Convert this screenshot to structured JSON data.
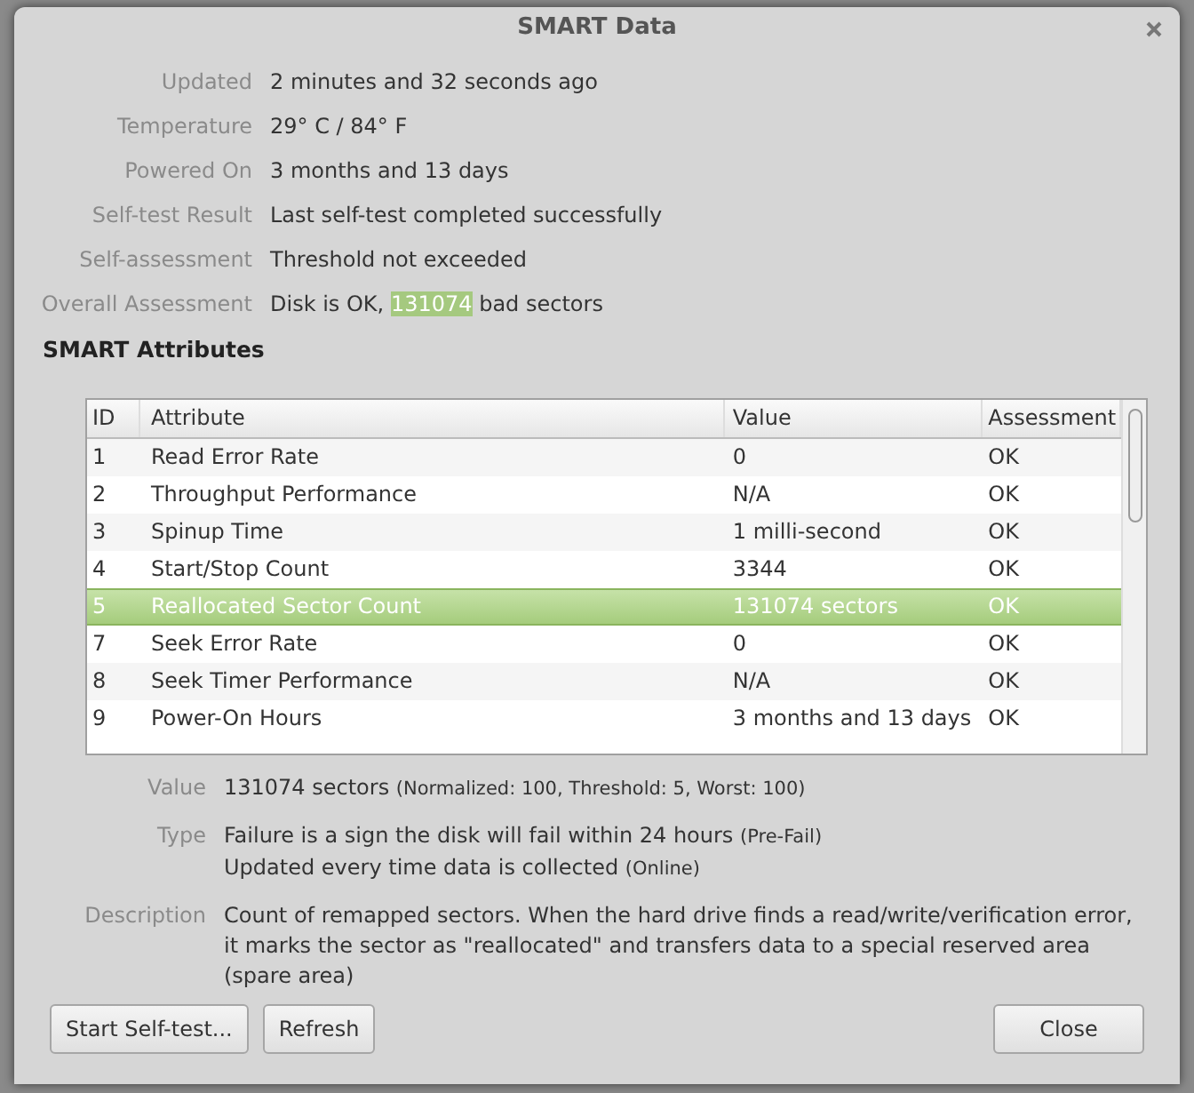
{
  "window": {
    "title": "SMART Data"
  },
  "summary": [
    {
      "label": "Updated",
      "value": "2 minutes and 32 seconds ago"
    },
    {
      "label": "Temperature",
      "value": "29° C / 84° F"
    },
    {
      "label": "Powered On",
      "value": "3 months and 13 days"
    },
    {
      "label": "Self-test Result",
      "value": "Last self-test completed successfully"
    },
    {
      "label": "Self-assessment",
      "value": "Threshold not exceeded"
    },
    {
      "label": "Overall Assessment",
      "value": "Disk is OK,",
      "highlight": "131074",
      "value_after": "bad sectors"
    }
  ],
  "section_title": "SMART Attributes",
  "table": {
    "columns": [
      "ID",
      "Attribute",
      "Value",
      "Assessment"
    ],
    "rows": [
      {
        "id": "1",
        "attribute": "Read Error Rate",
        "value": "0",
        "assessment": "OK",
        "selected": false
      },
      {
        "id": "2",
        "attribute": "Throughput Performance",
        "value": "N/A",
        "assessment": "OK",
        "selected": false
      },
      {
        "id": "3",
        "attribute": "Spinup Time",
        "value": "1 milli-second",
        "assessment": "OK",
        "selected": false
      },
      {
        "id": "4",
        "attribute": "Start/Stop Count",
        "value": "3344",
        "assessment": "OK",
        "selected": false
      },
      {
        "id": "5",
        "attribute": "Reallocated Sector Count",
        "value": "131074 sectors",
        "assessment": "OK",
        "selected": true
      },
      {
        "id": "7",
        "attribute": "Seek Error Rate",
        "value": "0",
        "assessment": "OK",
        "selected": false
      },
      {
        "id": "8",
        "attribute": "Seek Timer Performance",
        "value": "N/A",
        "assessment": "OK",
        "selected": false
      },
      {
        "id": "9",
        "attribute": "Power-On Hours",
        "value": "3 months and 13 days",
        "assessment": "OK",
        "selected": false
      }
    ]
  },
  "details": [
    {
      "label": "Value",
      "lines": [
        {
          "text": "131074 sectors",
          "note": "(Normalized: 100, Threshold: 5, Worst: 100)"
        }
      ]
    },
    {
      "label": "Type",
      "lines": [
        {
          "text": "Failure is a sign the disk will fail within 24 hours",
          "note": "(Pre-Fail)"
        },
        {
          "text": "Updated every time data is collected",
          "note": "(Online)"
        }
      ]
    },
    {
      "label": "Description",
      "lines": [
        {
          "text": "Count of remapped sectors. When the hard drive finds a read/write/verification error, it marks the sector as \"reallocated\" and transfers data to a special reserved area (spare area)"
        }
      ]
    }
  ],
  "buttons_left": [
    "Start Self-test...",
    "Refresh"
  ],
  "buttons_right": [
    "Close"
  ]
}
